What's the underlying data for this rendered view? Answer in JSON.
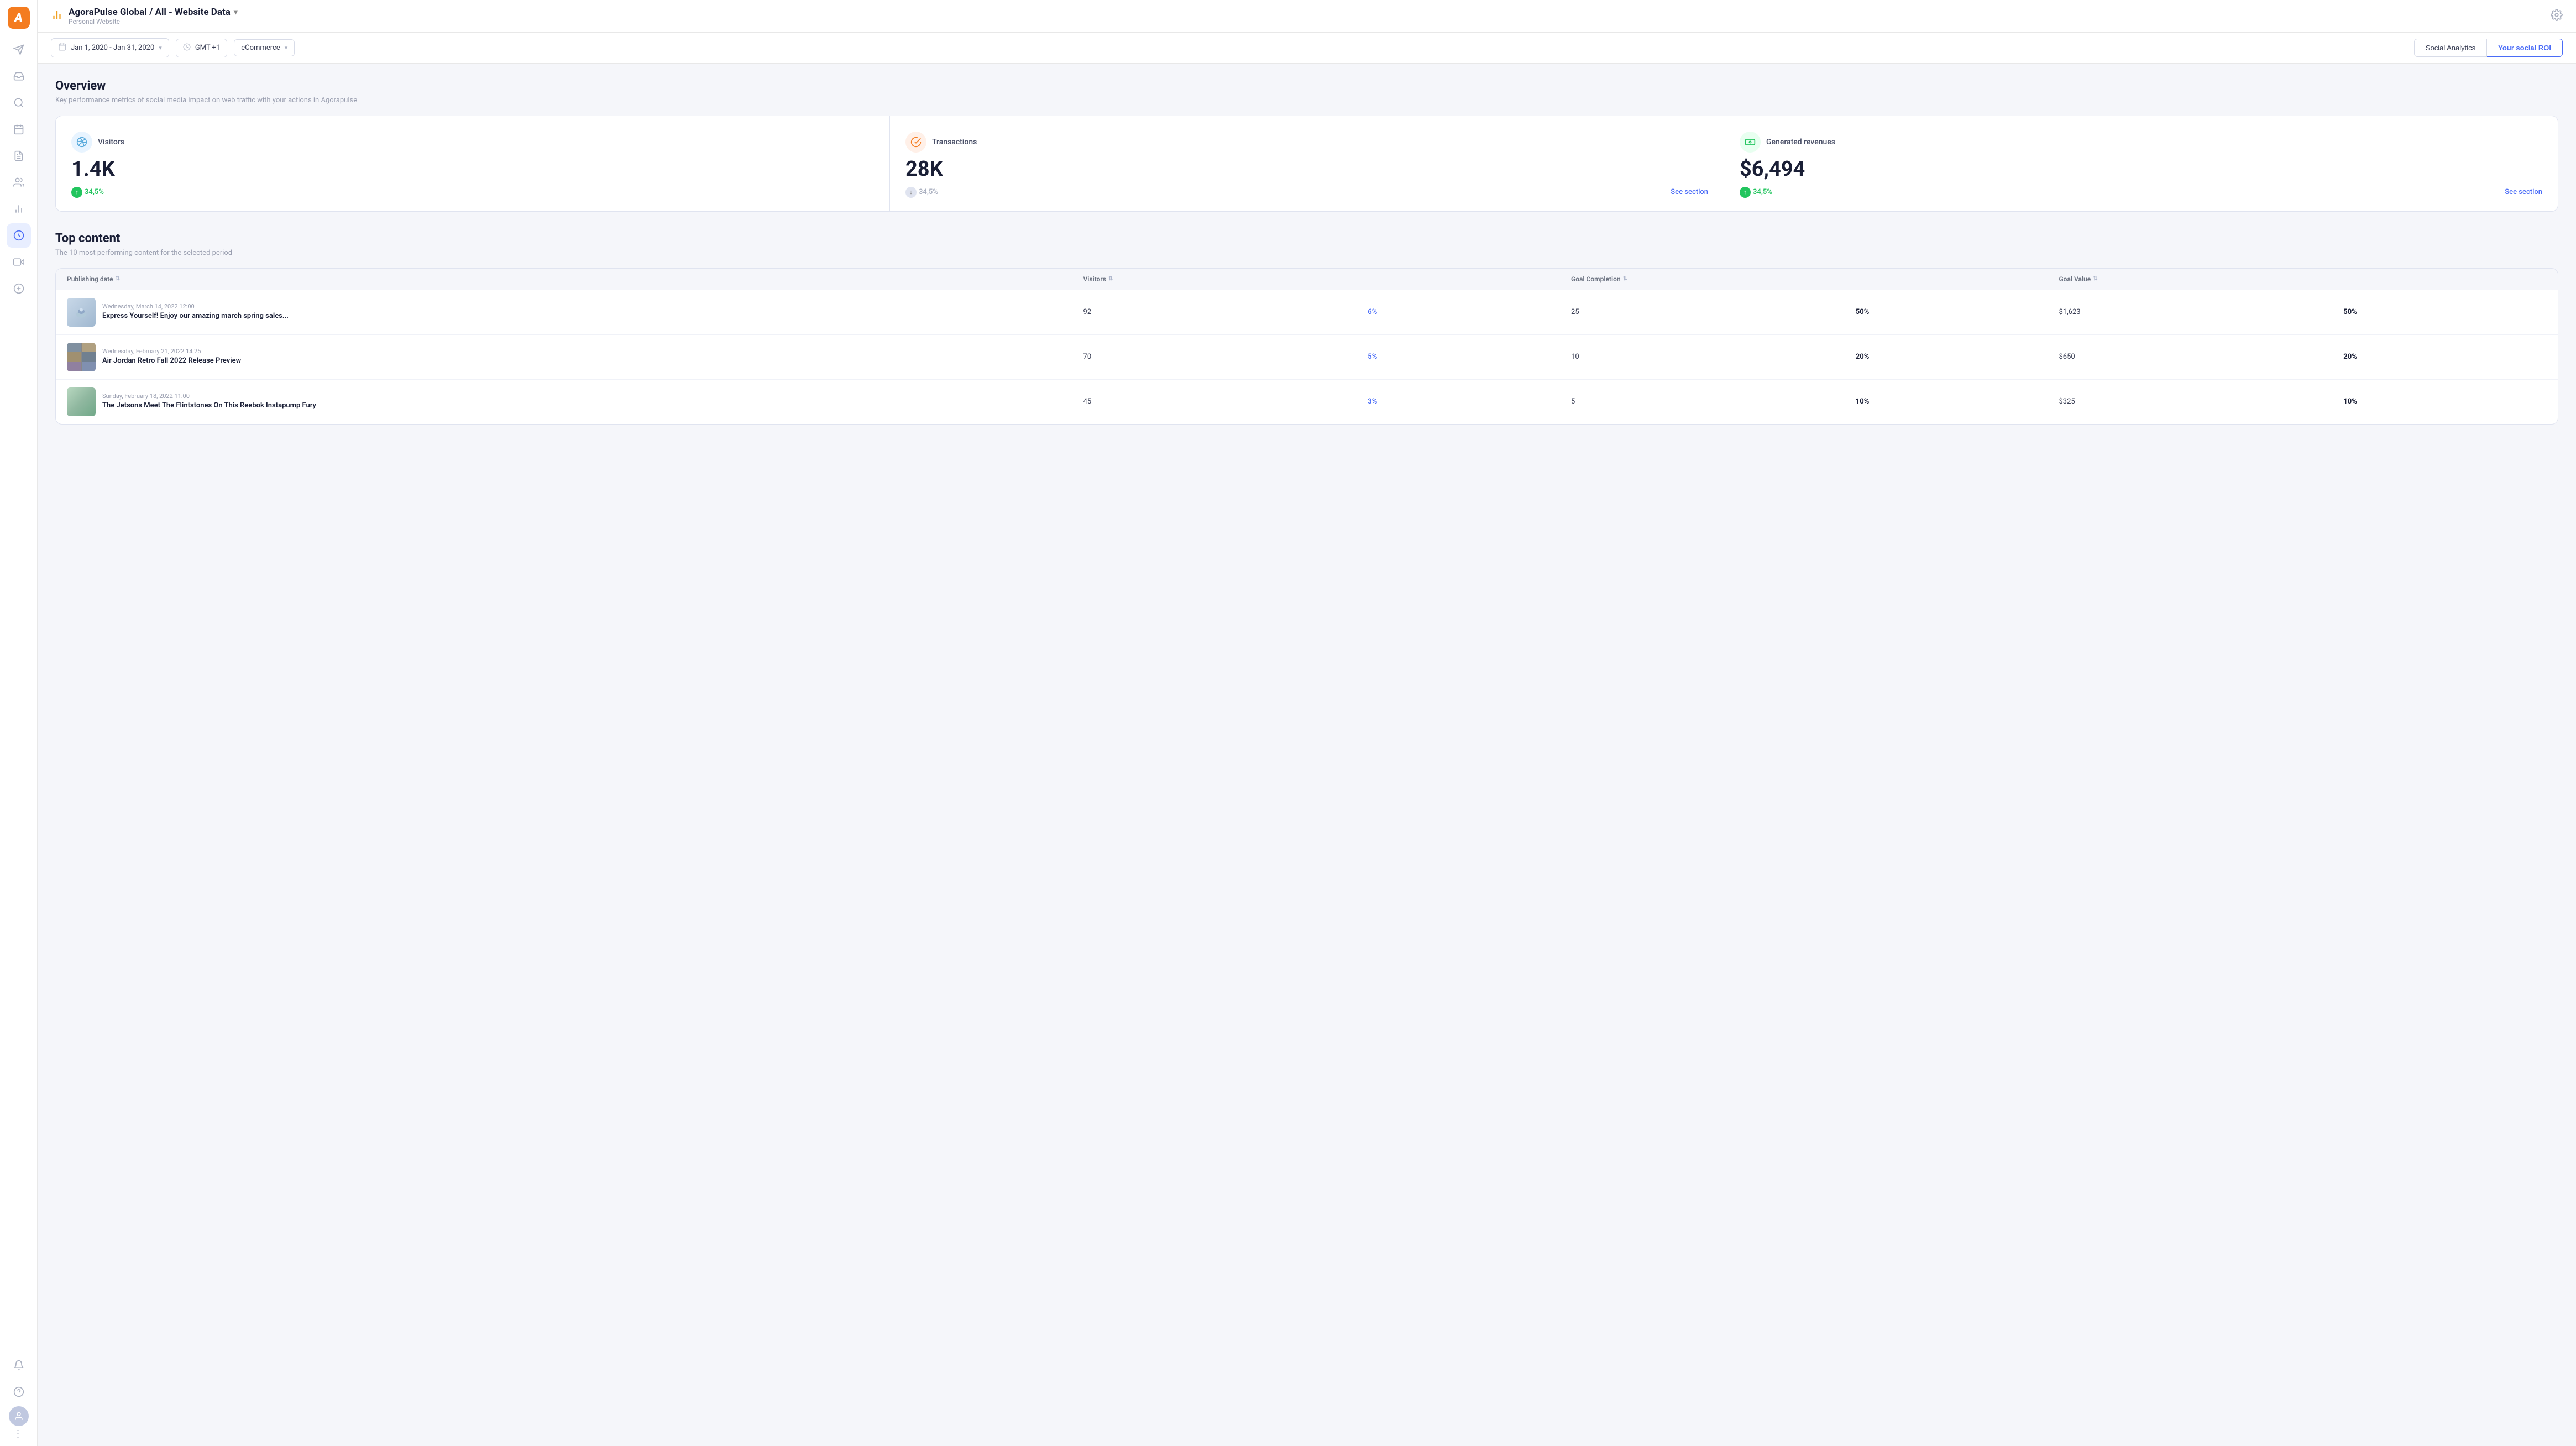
{
  "app": {
    "logo_letter": "a",
    "title": "AgoraPulse Global / All - Website Data",
    "subtitle": "Personal Website",
    "gear_label": "Settings"
  },
  "toolbar": {
    "date_range": "Jan 1, 2020 - Jan 31, 2020",
    "timezone": "GMT +1",
    "category": "eCommerce",
    "tab_social": "Social Analytics",
    "tab_roi": "Your social ROI"
  },
  "overview": {
    "title": "Overview",
    "subtitle": "Key performance metrics of social media impact on web traffic with your actions in Agorapulse",
    "metrics": [
      {
        "id": "visitors",
        "label": "Visitors",
        "icon": "📡",
        "icon_class": "blue",
        "value": "1.4K",
        "change": "34,5%",
        "change_dir": "up",
        "see_section": false
      },
      {
        "id": "transactions",
        "label": "Transactions",
        "icon": "✅",
        "icon_class": "orange",
        "value": "28K",
        "change": "34,5%",
        "change_dir": "down",
        "see_section": true,
        "see_section_label": "See section"
      },
      {
        "id": "revenue",
        "label": "Generated revenues",
        "icon": "💵",
        "icon_class": "green",
        "value": "$6,494",
        "change": "34,5%",
        "change_dir": "up",
        "see_section": true,
        "see_section_label": "See section"
      }
    ]
  },
  "top_content": {
    "title": "Top content",
    "subtitle": "The 10 most performing content for the selected period",
    "columns": [
      "Publishing date",
      "Visitors",
      "",
      "Goal Completion",
      "",
      "Goal Value",
      ""
    ],
    "rows": [
      {
        "date": "Wednesday, March 14, 2022 12:00",
        "title": "Express Yourself! Enjoy our amazing march spring sales...",
        "thumb_type": "1",
        "visitors": "92",
        "visitors_pct": "6%",
        "goal_completion": "25",
        "goal_completion_pct": "50%",
        "goal_value": "$1,623",
        "goal_value_pct": "50%"
      },
      {
        "date": "Wednesday, February 21, 2022 14:25",
        "title": "Air Jordan Retro Fall 2022 Release Preview",
        "thumb_type": "2",
        "visitors": "70",
        "visitors_pct": "5%",
        "goal_completion": "10",
        "goal_completion_pct": "20%",
        "goal_value": "$650",
        "goal_value_pct": "20%"
      },
      {
        "date": "Sunday, February 18, 2022 11:00",
        "title": "The Jetsons Meet The Flintstones On This Reebok Instapump Fury",
        "thumb_type": "3",
        "visitors": "45",
        "visitors_pct": "3%",
        "goal_completion": "5",
        "goal_completion_pct": "10%",
        "goal_value": "$325",
        "goal_value_pct": "10%"
      }
    ]
  },
  "sidebar": {
    "items": [
      {
        "id": "compose",
        "icon": "✈",
        "label": "Compose"
      },
      {
        "id": "inbox",
        "icon": "⊡",
        "label": "Inbox"
      },
      {
        "id": "listening",
        "icon": "◎",
        "label": "Listening"
      },
      {
        "id": "calendar",
        "icon": "▦",
        "label": "Calendar"
      },
      {
        "id": "reports",
        "icon": "≡",
        "label": "Reports"
      },
      {
        "id": "team",
        "icon": "⚇",
        "label": "Team"
      },
      {
        "id": "analytics",
        "icon": "▐",
        "label": "Analytics"
      },
      {
        "id": "roi",
        "icon": "⊙",
        "label": "ROI",
        "active": true
      },
      {
        "id": "media",
        "icon": "▷",
        "label": "Media"
      },
      {
        "id": "plus",
        "icon": "+",
        "label": "Add"
      }
    ],
    "bottom_items": [
      {
        "id": "notifications",
        "icon": "🔔",
        "label": "Notifications"
      },
      {
        "id": "help",
        "icon": "?",
        "label": "Help"
      },
      {
        "id": "avatar",
        "icon": "👤",
        "label": "Profile"
      }
    ]
  }
}
